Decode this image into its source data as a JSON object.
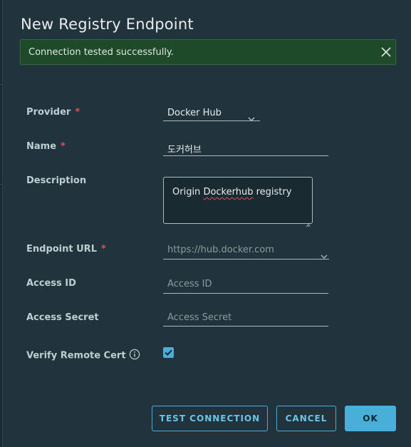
{
  "modal": {
    "title": "New Registry Endpoint",
    "alert": {
      "message": "Connection tested successfully.",
      "status_color": "#1f4a2a"
    }
  },
  "form": {
    "provider": {
      "label": "Provider",
      "required_mark": "*",
      "value": "Docker Hub"
    },
    "name": {
      "label": "Name",
      "required_mark": "*",
      "value": "도커허브"
    },
    "description": {
      "label": "Description",
      "value_prefix": "Origin ",
      "value_misspelled": "Dockerhub",
      "value_suffix": " registry"
    },
    "endpoint_url": {
      "label": "Endpoint URL",
      "required_mark": "*",
      "placeholder": "https://hub.docker.com"
    },
    "access_id": {
      "label": "Access ID",
      "placeholder": "Access ID"
    },
    "access_secret": {
      "label": "Access Secret",
      "placeholder": "Access Secret"
    },
    "verify_remote_cert": {
      "label": "Verify Remote Cert",
      "checked": true
    }
  },
  "buttons": {
    "test_connection": "TEST CONNECTION",
    "cancel": "CANCEL",
    "ok": "OK"
  },
  "colors": {
    "accent": "#49afd9",
    "required": "#e0505a",
    "background": "#21333b"
  }
}
